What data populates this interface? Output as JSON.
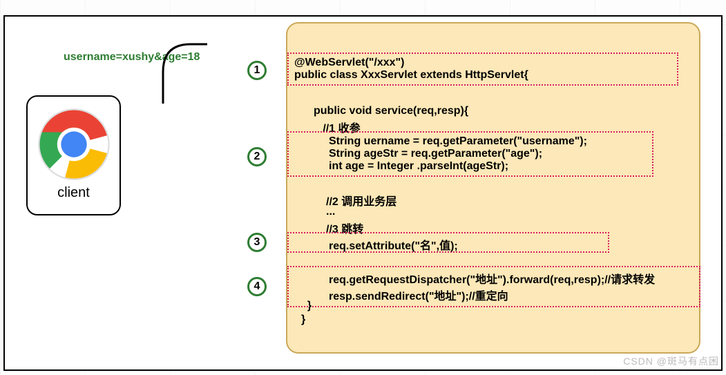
{
  "url_text": "username=xushy&age=18",
  "client": {
    "label": "client"
  },
  "circles": {
    "c1": "1",
    "c2": "2",
    "c3": "3",
    "c4": "4"
  },
  "code": {
    "block1_l1": "    @WebServlet(\"/xxx\")",
    "block1_l2": "public class XxxServlet extends HttpServlet{",
    "mid_l1": "public void service(req,resp){",
    "mid_l2": "   //1 收参",
    "block2_l1": "String uername = req.getParameter(\"username\");",
    "block2_l2": "String ageStr = req.getParameter(\"age\");",
    "block2_l3": " int age = Integer .parseInt(ageStr);",
    "mid_c1": "//2 调用业务层",
    "mid_c2": "...",
    "mid_c3": "//3 跳转",
    "block3_l1": "req.setAttribute(\"名\",值);",
    "block4_l1": "req.getRequestDispatcher(\"地址\").forward(req,resp);//请求转发",
    "block4_l2": "resp.sendRedirect(\"地址\");//重定向",
    "tail_l1": "  }",
    "tail_l2": "}"
  },
  "watermark": "CSDN @斑马有点困"
}
